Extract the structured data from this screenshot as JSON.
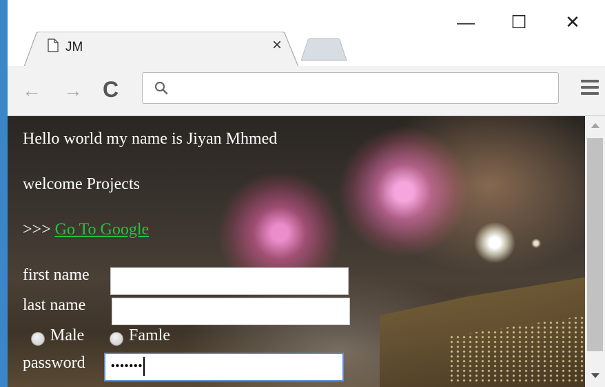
{
  "window": {
    "minimize_glyph": "—",
    "maximize_glyph": "☐",
    "close_glyph": "✕"
  },
  "tab": {
    "title": "JM",
    "close_glyph": "×",
    "icon": "page-icon"
  },
  "toolbar": {
    "back_glyph": "←",
    "forward_glyph": "→",
    "reload_glyph": "C",
    "address_value": "",
    "search_icon": "search-icon",
    "menu_icon": "hamburger-menu-icon"
  },
  "page": {
    "greeting": "Hello world my name is Jiyan Mhmed",
    "welcome": "welcome Projects",
    "link_prefix": ">>> ",
    "link_text": "Go To Google",
    "link_color": "#27c13f",
    "form": {
      "first_name_label": "first name",
      "first_name_value": "",
      "last_name_label": "last name",
      "last_name_value": "",
      "gender_options": [
        "Male",
        "Famle"
      ],
      "password_label": "password",
      "password_masked": "•••••••"
    }
  },
  "colors": {
    "window_accent": "#3b86c8",
    "focus_border": "#5b8ed6"
  }
}
